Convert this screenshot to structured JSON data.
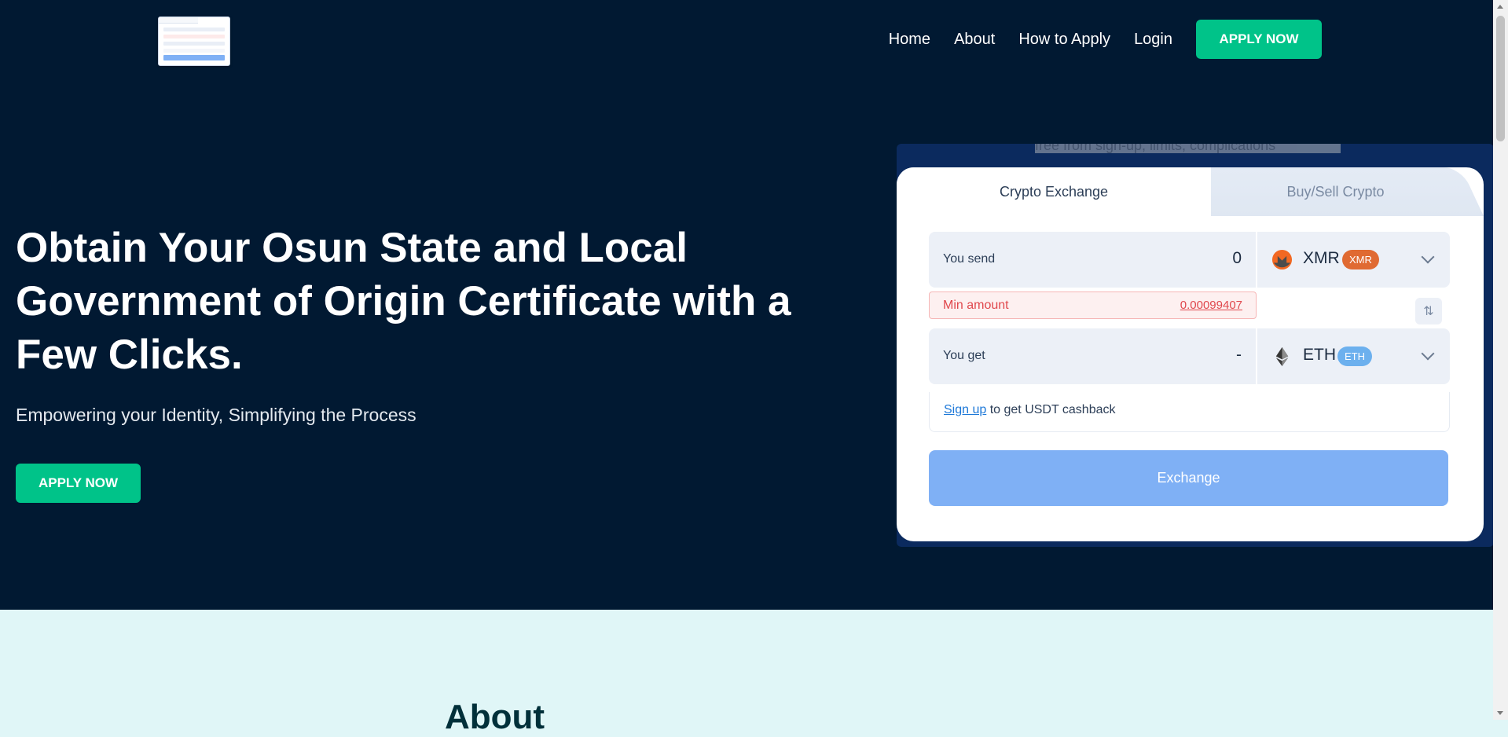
{
  "nav": {
    "items": [
      "Home",
      "About",
      "How to Apply",
      "Login"
    ],
    "apply_label": "APPLY NOW"
  },
  "hero": {
    "headline": "Obtain Your Osun State and Local Government of Origin Certificate with a Few Clicks.",
    "subline": "Empowering your Identity, Simplifying the Process",
    "apply_label": "APPLY NOW"
  },
  "widget": {
    "ghost_text": "free from sign-up, limits, complications",
    "tabs": [
      "Crypto Exchange",
      "Buy/Sell Crypto"
    ],
    "send": {
      "label": "You send",
      "value": "0",
      "currency": "XMR",
      "badge": "XMR",
      "badge_color": "#e06a32"
    },
    "min_amount": {
      "label": "Min amount",
      "value": "0.00099407"
    },
    "get": {
      "label": "You get",
      "value": "-",
      "currency": "ETH",
      "badge": "ETH",
      "badge_color": "#6cb0ee"
    },
    "cashback": {
      "link": "Sign up",
      "text": "to get USDT cashback"
    },
    "exchange_label": "Exchange"
  },
  "about": {
    "title": "About"
  },
  "colors": {
    "hero_bg": "#011932",
    "accent": "#00c389",
    "exchange_btn": "#7fb0f5"
  }
}
